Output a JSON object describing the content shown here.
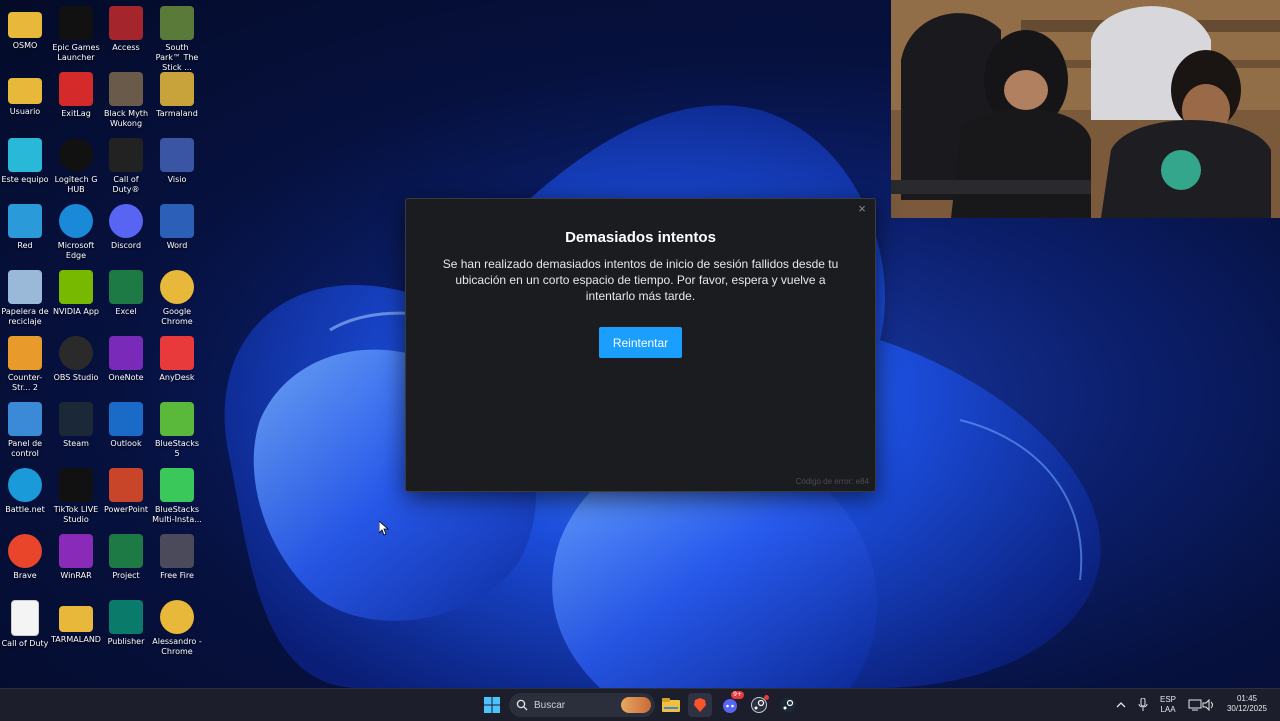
{
  "desktop": {
    "icons": [
      {
        "label": "OSMO",
        "icon": "folder-icon",
        "color": "#e8b83a"
      },
      {
        "label": "Epic Games Launcher",
        "icon": "epic-games-icon",
        "color": "#111111"
      },
      {
        "label": "Access",
        "icon": "access-icon",
        "color": "#a4262c"
      },
      {
        "label": "South Park™ The Stick ...",
        "icon": "south-park-icon",
        "color": "#5a7a3a"
      },
      {
        "label": "Usuario",
        "icon": "folder-icon",
        "color": "#e8b83a"
      },
      {
        "label": "ExitLag",
        "icon": "exitlag-icon",
        "color": "#d42a2a"
      },
      {
        "label": "Black Myth Wukong",
        "icon": "black-myth-icon",
        "color": "#6a5a4a"
      },
      {
        "label": "Tarmaland",
        "icon": "tarmaland-icon",
        "color": "#c8a23a"
      },
      {
        "label": "Este equipo",
        "icon": "monitor-icon",
        "color": "#2ab8d8"
      },
      {
        "label": "Logitech G HUB",
        "icon": "logitech-icon",
        "color": "#111111"
      },
      {
        "label": "Call of Duty®",
        "icon": "call-of-duty-icon",
        "color": "#222222"
      },
      {
        "label": "Visio",
        "icon": "visio-icon",
        "color": "#3955a3"
      },
      {
        "label": "Red",
        "icon": "network-icon",
        "color": "#2a9ad8"
      },
      {
        "label": "Microsoft Edge",
        "icon": "edge-icon",
        "color": "#1a8ad8"
      },
      {
        "label": "Discord",
        "icon": "discord-icon",
        "color": "#5865f2"
      },
      {
        "label": "Word",
        "icon": "word-icon",
        "color": "#2b5fb8"
      },
      {
        "label": "Papelera de reciclaje",
        "icon": "recycle-bin-icon",
        "color": "#9ab8d8"
      },
      {
        "label": "NVIDIA App",
        "icon": "nvidia-icon",
        "color": "#76b900"
      },
      {
        "label": "Excel",
        "icon": "excel-icon",
        "color": "#1d7a45"
      },
      {
        "label": "Google Chrome",
        "icon": "chrome-icon",
        "color": "#e8b83a"
      },
      {
        "label": "Counter-Str... 2",
        "icon": "counter-strike-icon",
        "color": "#e89a2a"
      },
      {
        "label": "OBS Studio",
        "icon": "obs-icon",
        "color": "#2a2a2a"
      },
      {
        "label": "OneNote",
        "icon": "onenote-icon",
        "color": "#7a2ab8"
      },
      {
        "label": "AnyDesk",
        "icon": "anydesk-icon",
        "color": "#e83a3a"
      },
      {
        "label": "Panel de control",
        "icon": "control-panel-icon",
        "color": "#3a8ad8"
      },
      {
        "label": "Steam",
        "icon": "steam-icon",
        "color": "#1b2838"
      },
      {
        "label": "Outlook",
        "icon": "outlook-icon",
        "color": "#1a6ac8"
      },
      {
        "label": "BlueStacks 5",
        "icon": "bluestacks-icon",
        "color": "#5ab83a"
      },
      {
        "label": "Battle.net",
        "icon": "battlenet-icon",
        "color": "#1a9ad8"
      },
      {
        "label": "TikTok LIVE Studio",
        "icon": "tiktok-icon",
        "color": "#111111"
      },
      {
        "label": "PowerPoint",
        "icon": "powerpoint-icon",
        "color": "#c8452a"
      },
      {
        "label": "BlueStacks Multi-Insta...",
        "icon": "bluestacks-multi-icon",
        "color": "#3ac85a"
      },
      {
        "label": "Brave",
        "icon": "brave-icon",
        "color": "#e8452a"
      },
      {
        "label": "WinRAR",
        "icon": "winrar-icon",
        "color": "#8a2ab8"
      },
      {
        "label": "Project",
        "icon": "project-icon",
        "color": "#1d7a45"
      },
      {
        "label": "Free Fire",
        "icon": "free-fire-icon",
        "color": "#4a4a5a"
      },
      {
        "label": "Call of Duty",
        "icon": "document-icon",
        "color": "#f4f4f4"
      },
      {
        "label": "TARMALAND",
        "icon": "folder-icon",
        "color": "#e8b83a"
      },
      {
        "label": "Publisher",
        "icon": "publisher-icon",
        "color": "#0a7a6a"
      },
      {
        "label": "Alessandro - Chrome",
        "icon": "chrome-profile-icon",
        "color": "#e8b83a"
      }
    ]
  },
  "dialog": {
    "title": "Demasiados intentos",
    "message": "Se han realizado demasiados intentos de inicio de sesión fallidos desde tu ubicación en un corto espacio de tiempo. Por favor, espera y vuelve a intentarlo más tarde.",
    "retry_label": "Reintentar",
    "error_code": "Código de error: e84",
    "close_glyph": "×"
  },
  "taskbar": {
    "search_placeholder": "Buscar",
    "apps": [
      "start-icon",
      "search-icon",
      "widget-icon",
      "file-explorer-icon",
      "brave-icon",
      "discord-icon",
      "steam-icon",
      "steam-icon"
    ],
    "discord_badge": "9+",
    "language": "ESP",
    "layout": "LAA",
    "time": "01:45",
    "date": "30/12/2025"
  }
}
